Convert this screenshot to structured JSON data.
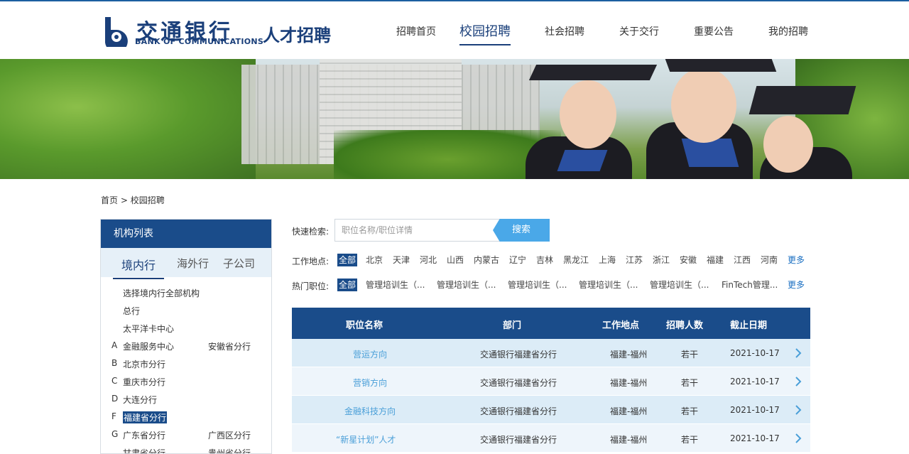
{
  "logo": {
    "cn": "交通银行",
    "en": "BANK OF COMMUNICATIONS",
    "suffix": "人才招聘"
  },
  "nav": [
    {
      "label": "招聘首页",
      "active": false
    },
    {
      "label": "校园招聘",
      "active": true
    },
    {
      "label": "社会招聘",
      "active": false
    },
    {
      "label": "关于交行",
      "active": false
    },
    {
      "label": "重要公告",
      "active": false
    },
    {
      "label": "我的招聘",
      "active": false
    }
  ],
  "breadcrumb": {
    "home": "首页",
    "sep": ">",
    "current": "校园招聘"
  },
  "sidebar": {
    "title": "机构列表",
    "tabs": [
      {
        "label": "境内行",
        "active": true
      },
      {
        "label": "海外行",
        "active": false
      },
      {
        "label": "子公司",
        "active": false
      }
    ],
    "rows": [
      {
        "letter": "",
        "o1": "选择境内行全部机构",
        "o2": ""
      },
      {
        "letter": "",
        "o1": "总行",
        "o2": ""
      },
      {
        "letter": "",
        "o1": "太平洋卡中心",
        "o2": ""
      },
      {
        "letter": "A",
        "o1": "金融服务中心",
        "o2": "安徽省分行"
      },
      {
        "letter": "B",
        "o1": "北京市分行",
        "o2": ""
      },
      {
        "letter": "C",
        "o1": "重庆市分行",
        "o2": ""
      },
      {
        "letter": "D",
        "o1": "大连分行",
        "o2": ""
      },
      {
        "letter": "F",
        "o1": "福建省分行",
        "o2": "",
        "selected": true
      },
      {
        "letter": "G",
        "o1": "广东省分行",
        "o2": "广西区分行"
      },
      {
        "letter": "",
        "o1": "甘肃省分行",
        "o2": "贵州省分行"
      }
    ]
  },
  "search": {
    "label": "快速检索:",
    "placeholder": "职位名称/职位详情",
    "value": "",
    "button": "搜索"
  },
  "location_filter": {
    "label": "工作地点:",
    "items": [
      "全部",
      "北京",
      "天津",
      "河北",
      "山西",
      "内蒙古",
      "辽宁",
      "吉林",
      "黑龙江",
      "上海",
      "江苏",
      "浙江",
      "安徽",
      "福建",
      "江西",
      "河南"
    ],
    "active": "全部",
    "more": "更多"
  },
  "position_filter": {
    "label": "热门职位:",
    "items": [
      "全部",
      "管理培训生（...",
      "管理培训生（...",
      "管理培训生（...",
      "管理培训生（...",
      "管理培训生（...",
      "FinTech管理..."
    ],
    "active": "全部",
    "more": "更多"
  },
  "table": {
    "headers": {
      "title": "职位名称",
      "dept": "部门",
      "location": "工作地点",
      "count": "招聘人数",
      "deadline": "截止日期"
    },
    "rows": [
      {
        "title": "营运方向",
        "dept": "交通银行福建省分行",
        "location": "福建-福州",
        "count": "若干",
        "deadline": "2021-10-17"
      },
      {
        "title": "营销方向",
        "dept": "交通银行福建省分行",
        "location": "福建-福州",
        "count": "若干",
        "deadline": "2021-10-17"
      },
      {
        "title": "金融科技方向",
        "dept": "交通银行福建省分行",
        "location": "福建-福州",
        "count": "若干",
        "deadline": "2021-10-17"
      },
      {
        "title": "“新星计划”人才",
        "dept": "交通银行福建省分行",
        "location": "福建-福州",
        "count": "若干",
        "deadline": "2021-10-17"
      }
    ]
  },
  "colors": {
    "brand": "#1a4c8a",
    "accent": "#4aa8e8",
    "link": "#4a9fd8",
    "row_odd": "#dcecf7",
    "row_even": "#eef5fb"
  },
  "icons": {
    "row_action": "chevron-right-icon",
    "logo": "bank-logo-icon"
  }
}
